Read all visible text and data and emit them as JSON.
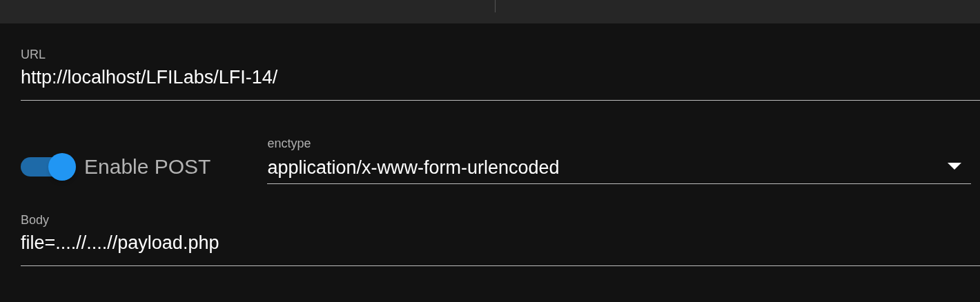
{
  "url_field": {
    "label": "URL",
    "value": "http://localhost/LFILabs/LFI-14/"
  },
  "post_toggle": {
    "label": "Enable POST",
    "on": true
  },
  "enctype_field": {
    "label": "enctype",
    "value": "application/x-www-form-urlencoded"
  },
  "body_field": {
    "label": "Body",
    "value": "file=....//....//payload.php"
  }
}
